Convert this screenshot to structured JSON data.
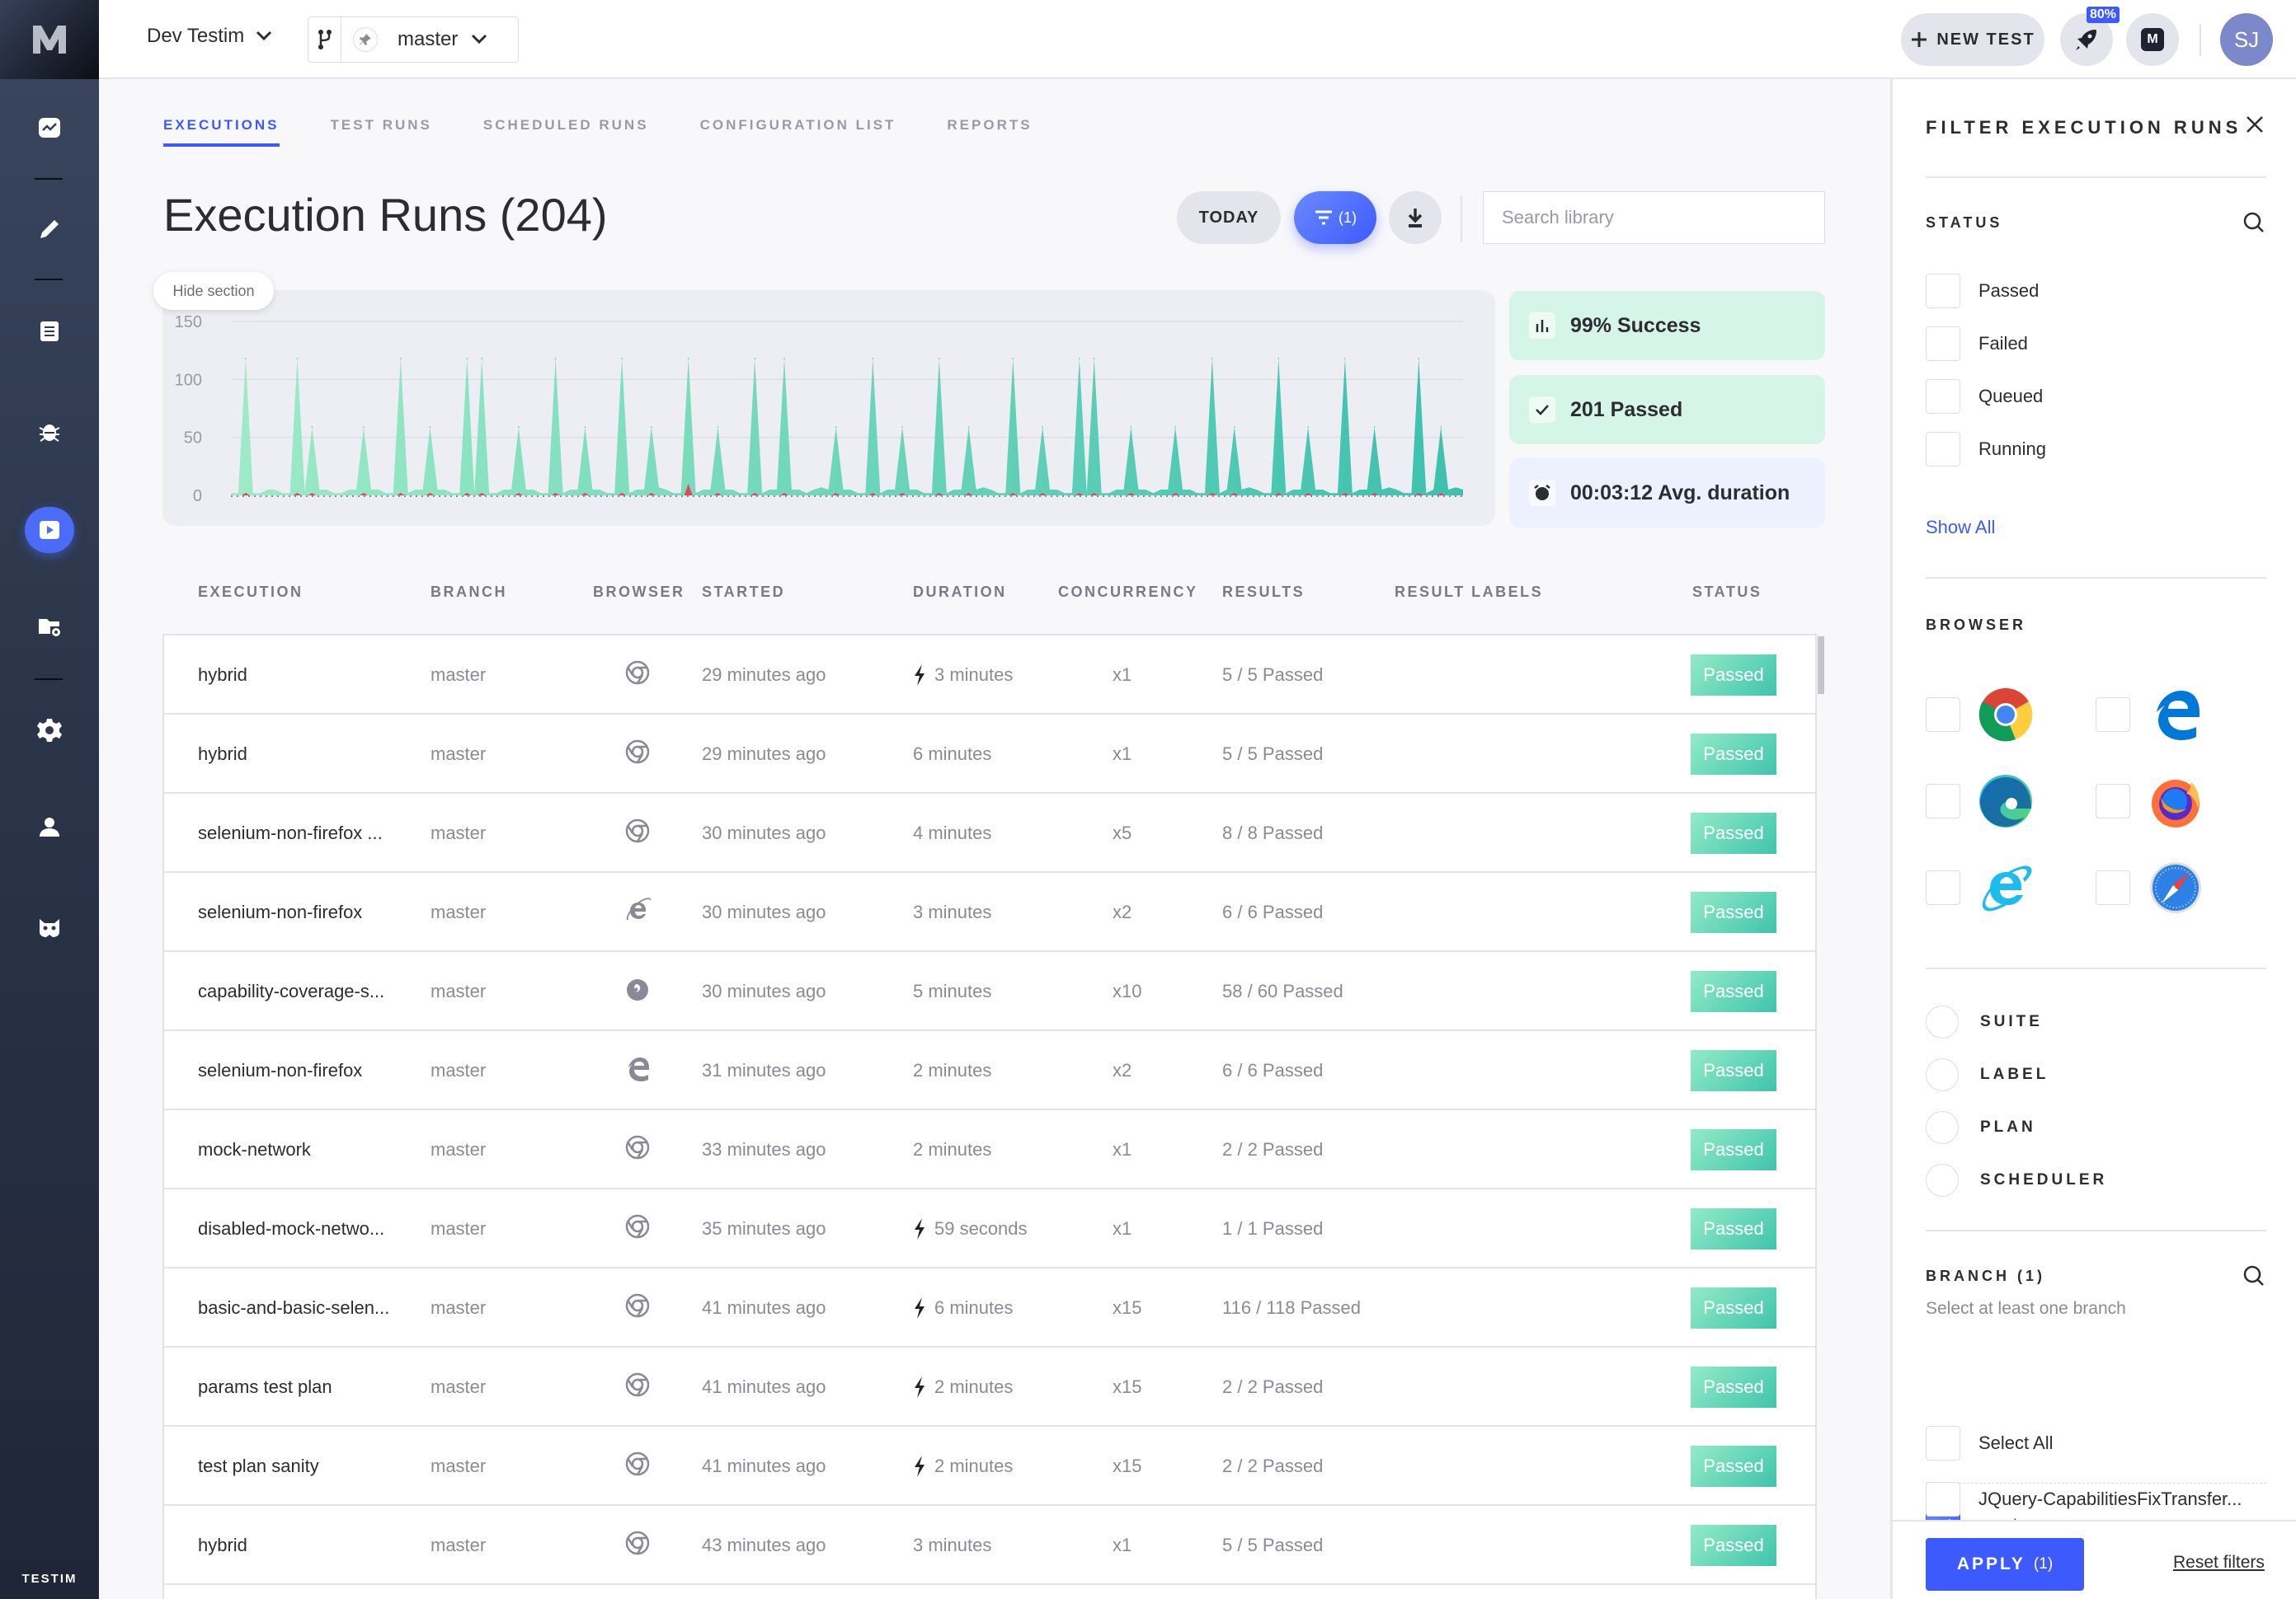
{
  "app": {
    "brand": "TESTIM",
    "logo": "M"
  },
  "sidebar": {
    "items": [
      {
        "name": "dashboard",
        "icon": "chart-line-icon"
      },
      {
        "name": "editor",
        "icon": "pencil-icon"
      },
      {
        "name": "tests",
        "icon": "list-icon"
      },
      {
        "name": "bugs",
        "icon": "bug-icon"
      },
      {
        "name": "runs",
        "icon": "play-icon",
        "active": true
      },
      {
        "name": "grid",
        "icon": "folder-gear-icon"
      },
      {
        "name": "settings",
        "icon": "gear-icon"
      },
      {
        "name": "users",
        "icon": "user-icon"
      },
      {
        "name": "mask",
        "icon": "mask-icon"
      }
    ]
  },
  "header": {
    "project": "Dev Testim",
    "branch": "master",
    "new_test_label": "NEW TEST",
    "progress_badge": "80%",
    "avatar_initials": "SJ"
  },
  "tabs": [
    {
      "label": "EXECUTIONS",
      "active": true
    },
    {
      "label": "TEST RUNS"
    },
    {
      "label": "SCHEDULED RUNS"
    },
    {
      "label": "CONFIGURATION LIST"
    },
    {
      "label": "REPORTS"
    }
  ],
  "page": {
    "title": "Execution Runs (204)",
    "today_label": "TODAY",
    "filter_count": "(1)",
    "search_placeholder": "Search library",
    "hide_section_label": "Hide section"
  },
  "stats": [
    {
      "text": "99% Success",
      "icon": "bar-chart-icon",
      "color": "#d4f5e7"
    },
    {
      "text": "201 Passed",
      "icon": "check-icon",
      "color": "#d4f5e7"
    },
    {
      "text": "00:03:12 Avg. duration",
      "icon": "alarm-clock-icon",
      "color": "#edf1fe"
    }
  ],
  "chart_data": {
    "type": "area",
    "title": "",
    "xlabel": "",
    "ylabel": "",
    "ylim": [
      0,
      150
    ],
    "yticks": [
      0,
      50,
      100,
      150
    ],
    "grid": true,
    "series": [
      {
        "name": "Passed",
        "color": "#5fd3b5",
        "values": [
          2,
          2,
          118,
          2,
          2,
          5,
          5,
          2,
          2,
          118,
          3,
          59,
          5,
          5,
          2,
          2,
          5,
          5,
          59,
          5,
          5,
          2,
          2,
          118,
          2,
          5,
          5,
          59,
          5,
          5,
          2,
          2,
          118,
          2,
          118,
          2,
          2,
          5,
          5,
          59,
          5,
          5,
          2,
          2,
          118,
          2,
          5,
          5,
          59,
          5,
          5,
          2,
          2,
          118,
          2,
          5,
          5,
          59,
          7,
          5,
          2,
          2,
          118,
          2,
          5,
          5,
          59,
          5,
          5,
          2,
          2,
          118,
          2,
          5,
          5,
          118,
          5,
          5,
          2,
          5,
          7,
          5,
          59,
          5,
          5,
          2,
          2,
          118,
          2,
          5,
          5,
          59,
          5,
          5,
          2,
          2,
          118,
          2,
          5,
          5,
          59,
          5,
          7,
          5,
          2,
          2,
          118,
          2,
          5,
          5,
          59,
          5,
          5,
          2,
          2,
          118,
          2,
          118,
          2,
          2,
          5,
          5,
          59,
          5,
          5,
          2,
          5,
          5,
          59,
          5,
          5,
          2,
          2,
          118,
          2,
          5,
          59,
          5,
          7,
          5,
          2,
          2,
          118,
          2,
          5,
          5,
          59,
          5,
          5,
          2,
          2,
          118,
          2,
          5,
          5,
          59,
          5,
          7,
          5,
          2,
          2,
          118,
          2,
          5,
          59,
          5,
          7,
          5
        ]
      },
      {
        "name": "Failed",
        "color": "#e8455a",
        "values_note": "small failures near 0 with one visible spike",
        "spike_index": 62,
        "spike_value": 10
      }
    ]
  },
  "table": {
    "columns": [
      "EXECUTION",
      "BRANCH",
      "BROWSER",
      "STARTED",
      "DURATION",
      "CONCURRENCY",
      "RESULTS",
      "RESULT LABELS",
      "STATUS"
    ],
    "rows": [
      {
        "execution": "hybrid",
        "branch": "master",
        "browser": "chrome",
        "started": "29 minutes ago",
        "duration": "3 minutes",
        "turbo": true,
        "concurrency": "x1",
        "results": "5 / 5 Passed",
        "labels": "",
        "status": "Passed"
      },
      {
        "execution": "hybrid",
        "branch": "master",
        "browser": "chrome",
        "started": "29 minutes ago",
        "duration": "6 minutes",
        "turbo": false,
        "concurrency": "x1",
        "results": "5 / 5 Passed",
        "labels": "",
        "status": "Passed"
      },
      {
        "execution": "selenium-non-firefox ...",
        "branch": "master",
        "browser": "chrome",
        "started": "30 minutes ago",
        "duration": "4 minutes",
        "turbo": false,
        "concurrency": "x5",
        "results": "8 / 8 Passed",
        "labels": "",
        "status": "Passed"
      },
      {
        "execution": "selenium-non-firefox",
        "branch": "master",
        "browser": "ie",
        "started": "30 minutes ago",
        "duration": "3 minutes",
        "turbo": false,
        "concurrency": "x2",
        "results": "6 / 6 Passed",
        "labels": "",
        "status": "Passed"
      },
      {
        "execution": "capability-coverage-s...",
        "branch": "master",
        "browser": "firefox",
        "started": "30 minutes ago",
        "duration": "5 minutes",
        "turbo": false,
        "concurrency": "x10",
        "results": "58 / 60 Passed",
        "labels": "",
        "status": "Passed"
      },
      {
        "execution": "selenium-non-firefox",
        "branch": "master",
        "browser": "edge",
        "started": "31 minutes ago",
        "duration": "2 minutes",
        "turbo": false,
        "concurrency": "x2",
        "results": "6 / 6 Passed",
        "labels": "",
        "status": "Passed"
      },
      {
        "execution": "mock-network",
        "branch": "master",
        "browser": "chrome",
        "started": "33 minutes ago",
        "duration": "2 minutes",
        "turbo": false,
        "concurrency": "x1",
        "results": "2 / 2 Passed",
        "labels": "",
        "status": "Passed"
      },
      {
        "execution": "disabled-mock-netwo...",
        "branch": "master",
        "browser": "chrome",
        "started": "35 minutes ago",
        "duration": "59 seconds",
        "turbo": true,
        "concurrency": "x1",
        "results": "1 / 1 Passed",
        "labels": "",
        "status": "Passed"
      },
      {
        "execution": "basic-and-basic-selen...",
        "branch": "master",
        "browser": "chrome",
        "started": "41 minutes ago",
        "duration": "6 minutes",
        "turbo": true,
        "concurrency": "x15",
        "results": "116 / 118 Passed",
        "labels": "",
        "status": "Passed"
      },
      {
        "execution": "params test plan",
        "branch": "master",
        "browser": "chrome",
        "started": "41 minutes ago",
        "duration": "2 minutes",
        "turbo": true,
        "concurrency": "x15",
        "results": "2 / 2 Passed",
        "labels": "",
        "status": "Passed"
      },
      {
        "execution": "test plan sanity",
        "branch": "master",
        "browser": "chrome",
        "started": "41 minutes ago",
        "duration": "2 minutes",
        "turbo": true,
        "concurrency": "x15",
        "results": "2 / 2 Passed",
        "labels": "",
        "status": "Passed"
      },
      {
        "execution": "hybrid",
        "branch": "master",
        "browser": "chrome",
        "started": "43 minutes ago",
        "duration": "3 minutes",
        "turbo": false,
        "concurrency": "x1",
        "results": "5 / 5 Passed",
        "labels": "",
        "status": "Passed"
      }
    ]
  },
  "filter": {
    "title": "FILTER EXECUTION RUNS",
    "status": {
      "label": "STATUS",
      "options": [
        {
          "label": "Passed",
          "checked": false
        },
        {
          "label": "Failed",
          "checked": false
        },
        {
          "label": "Queued",
          "checked": false
        },
        {
          "label": "Running",
          "checked": false
        }
      ],
      "show_all": "Show All"
    },
    "browser": {
      "label": "BROWSER",
      "options": [
        {
          "name": "chrome",
          "checked": false
        },
        {
          "name": "edge-legacy",
          "checked": false
        },
        {
          "name": "edge-chromium",
          "checked": false
        },
        {
          "name": "firefox",
          "checked": false
        },
        {
          "name": "internet-explorer",
          "checked": false
        },
        {
          "name": "safari",
          "checked": false
        }
      ]
    },
    "source": {
      "options": [
        {
          "label": "SUITE",
          "selected": false
        },
        {
          "label": "LABEL",
          "selected": false
        },
        {
          "label": "PLAN",
          "selected": false
        },
        {
          "label": "SCHEDULER",
          "selected": false
        }
      ]
    },
    "branch": {
      "label": "BRANCH (1)",
      "hint": "Select at least one branch",
      "select_all": "Select All",
      "options": [
        {
          "label": "master",
          "checked": true
        },
        {
          "label": "JQuery-CapabilitiesFixTransfer...",
          "checked": false
        }
      ]
    },
    "apply_label": "APPLY",
    "apply_count": "(1)",
    "reset_label": "Reset filters"
  },
  "colors": {
    "accent": "#3d5afe",
    "passed": "#3fc4ad",
    "failed": "#e8455a"
  }
}
